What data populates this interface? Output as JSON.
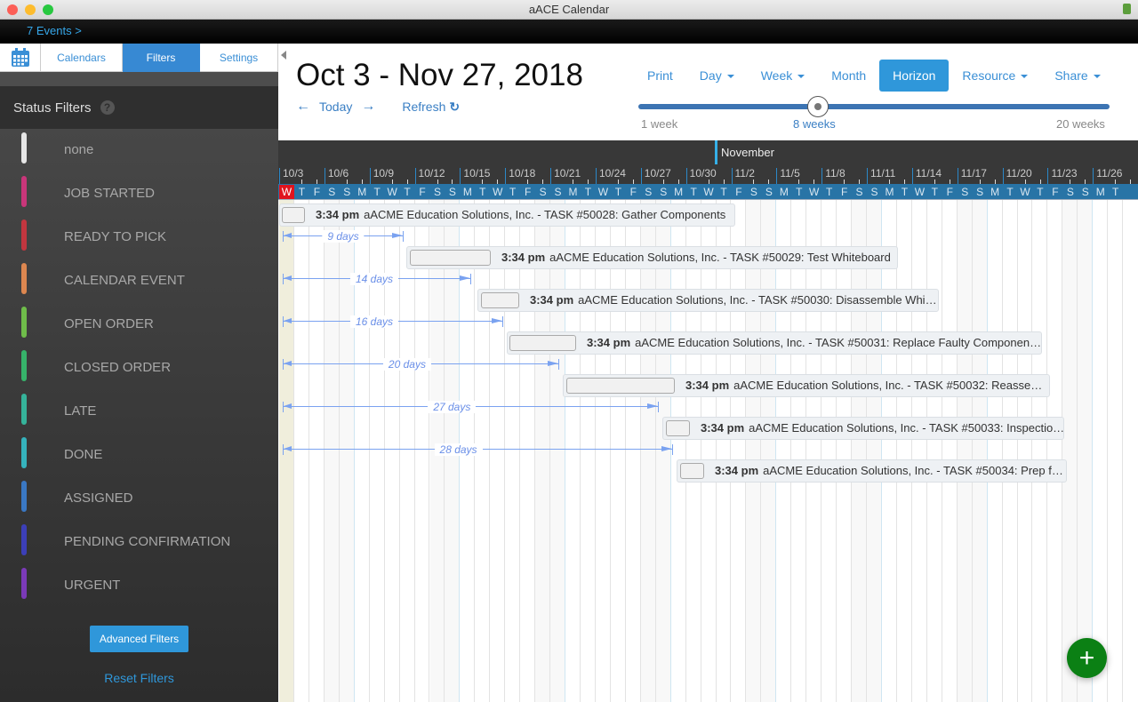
{
  "window": {
    "title": "aACE Calendar"
  },
  "topbar": {
    "events_link": "7 Events >"
  },
  "sidebar": {
    "tabs": [
      {
        "label": "Calendars"
      },
      {
        "label": "Filters",
        "active": true
      },
      {
        "label": "Settings"
      }
    ],
    "status_title": "Status Filters",
    "help": "?",
    "filters": [
      {
        "label": "none",
        "color": "#e6e6e6"
      },
      {
        "label": "JOB STARTED",
        "color": "#c9367a"
      },
      {
        "label": "READY TO PICK",
        "color": "#c2363f"
      },
      {
        "label": "CALENDAR EVENT",
        "color": "#dd8750"
      },
      {
        "label": "OPEN ORDER",
        "color": "#6fbd4a"
      },
      {
        "label": "CLOSED ORDER",
        "color": "#36b36a"
      },
      {
        "label": "LATE",
        "color": "#35b39a"
      },
      {
        "label": "DONE",
        "color": "#35b3bd"
      },
      {
        "label": "ASSIGNED",
        "color": "#3a78c4"
      },
      {
        "label": "PENDING CONFIRMATION",
        "color": "#3c3fb8"
      },
      {
        "label": "URGENT",
        "color": "#7b3ab8"
      }
    ],
    "advanced_filters": "Advanced Filters",
    "reset_filters": "Reset Filters"
  },
  "header": {
    "date_range": "Oct 3 - Nov 27, 2018",
    "today": "Today",
    "refresh": "Refresh",
    "toolbar": {
      "print": "Print",
      "day": "Day",
      "week": "Week",
      "month": "Month",
      "horizon": "Horizon",
      "resource": "Resource",
      "share": "Share"
    },
    "slider": {
      "min_label": "1 week",
      "value_label": "8 weeks",
      "max_label": "20 weeks",
      "value_weeks": 8
    }
  },
  "timeline": {
    "month_label": "November",
    "date_ticks": [
      "10/3",
      "10/6",
      "10/9",
      "10/12",
      "10/15",
      "10/18",
      "10/21",
      "10/24",
      "10/27",
      "10/30",
      "11/2",
      "11/5",
      "11/8",
      "11/11",
      "11/14",
      "11/17",
      "11/20",
      "11/23",
      "11/26"
    ],
    "day_letters": [
      "W",
      "T",
      "F",
      "S",
      "S",
      "M",
      "T",
      "W",
      "T",
      "F",
      "S",
      "S",
      "M",
      "T",
      "W",
      "T",
      "F",
      "S",
      "S",
      "M",
      "T",
      "W",
      "T",
      "F",
      "S",
      "S",
      "M",
      "T",
      "W",
      "T",
      "F",
      "S",
      "S",
      "M",
      "T",
      "W",
      "T",
      "F",
      "S",
      "S",
      "M",
      "T",
      "W",
      "T",
      "F",
      "S",
      "S",
      "M",
      "T",
      "W",
      "T",
      "F",
      "S",
      "S",
      "M",
      "T"
    ],
    "today_color": "#e0141e"
  },
  "events": [
    {
      "time": "3:34 pm",
      "title": "aACME Education Solutions, Inc. - TASK #50028: Gather Components"
    },
    {
      "time": "3:34 pm",
      "title": "aACME Education Solutions, Inc. - TASK #50029: Test Whiteboard"
    },
    {
      "time": "3:34 pm",
      "title": "aACME Education Solutions, Inc. - TASK #50030: Disassemble Whi…"
    },
    {
      "time": "3:34 pm",
      "title": "aACME Education Solutions, Inc. - TASK #50031: Replace Faulty Componen…"
    },
    {
      "time": "3:34 pm",
      "title": "aACME Education Solutions, Inc. - TASK #50032: Reasse…"
    },
    {
      "time": "3:34 pm",
      "title": "aACME Education Solutions, Inc. - TASK #50033: Inspectio…"
    },
    {
      "time": "3:34 pm",
      "title": "aACME Education Solutions, Inc. - TASK #50034: Prep f…"
    }
  ],
  "gaps": [
    "9 days",
    "14 days",
    "16 days",
    "20 days",
    "27 days",
    "28 days"
  ],
  "fab": "+"
}
